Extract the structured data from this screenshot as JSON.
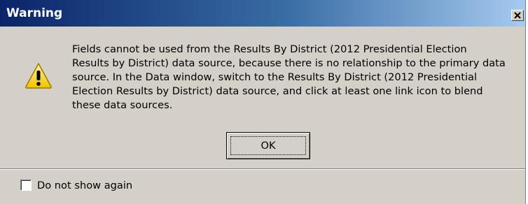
{
  "dialog": {
    "title": "Warning",
    "close_icon": "close-icon",
    "icon": "warning-icon",
    "message": "Fields cannot be used from the Results By District (2012 Presidential Election Results by District) data source, because there is no relationship to the primary data source. In the Data window, switch to the Results By District (2012 Presidential Election Results by District) data source, and click at least one link icon to blend these data sources.",
    "ok_label": "OK",
    "checkbox_label": "Do not show again",
    "checkbox_checked": false
  },
  "colors": {
    "titlebar_start": "#0a246a",
    "titlebar_end": "#a6caf0",
    "dialog_bg": "#d4d0c8",
    "warning_yellow": "#f7d21b"
  }
}
